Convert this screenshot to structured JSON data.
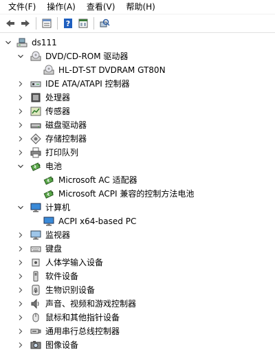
{
  "menu": [
    {
      "label": "文件(F)"
    },
    {
      "label": "操作(A)"
    },
    {
      "label": "查看(V)"
    },
    {
      "label": "帮助(H)"
    }
  ],
  "toolbar": {
    "buttons": [
      "back-arrow-icon",
      "forward-arrow-icon",
      "properties-icon",
      "help-icon",
      "view-icon",
      "scan-hardware-icon"
    ]
  },
  "tree": [
    {
      "label": "ds111",
      "level": 0,
      "expanded": true,
      "icon": "computer-root-icon"
    },
    {
      "label": "DVD/CD-ROM 驱动器",
      "level": 1,
      "expanded": true,
      "icon": "dvd-drive-icon"
    },
    {
      "label": "HL-DT-ST DVDRAM GT80N",
      "level": 2,
      "icon": "dvd-drive-icon"
    },
    {
      "label": "IDE ATA/ATAPI 控制器",
      "level": 1,
      "expanded": false,
      "icon": "ide-controller-icon"
    },
    {
      "label": "处理器",
      "level": 1,
      "expanded": false,
      "icon": "processor-icon"
    },
    {
      "label": "传感器",
      "level": 1,
      "expanded": false,
      "icon": "sensor-icon"
    },
    {
      "label": "磁盘驱动器",
      "level": 1,
      "expanded": false,
      "icon": "disk-drive-icon"
    },
    {
      "label": "存储控制器",
      "level": 1,
      "expanded": false,
      "icon": "storage-controller-icon"
    },
    {
      "label": "打印队列",
      "level": 1,
      "expanded": false,
      "icon": "printer-icon"
    },
    {
      "label": "电池",
      "level": 1,
      "expanded": true,
      "icon": "battery-icon"
    },
    {
      "label": "Microsoft AC 适配器",
      "level": 2,
      "icon": "battery-icon"
    },
    {
      "label": "Microsoft ACPI 兼容的控制方法电池",
      "level": 2,
      "icon": "battery-icon"
    },
    {
      "label": "计算机",
      "level": 1,
      "expanded": true,
      "icon": "monitor-icon"
    },
    {
      "label": "ACPI x64-based PC",
      "level": 2,
      "icon": "monitor-icon"
    },
    {
      "label": "监视器",
      "level": 1,
      "expanded": false,
      "icon": "display-icon"
    },
    {
      "label": "键盘",
      "level": 1,
      "expanded": false,
      "icon": "keyboard-icon"
    },
    {
      "label": "人体学输入设备",
      "level": 1,
      "expanded": false,
      "icon": "hid-icon"
    },
    {
      "label": "软件设备",
      "level": 1,
      "expanded": false,
      "icon": "software-device-icon"
    },
    {
      "label": "生物识别设备",
      "level": 1,
      "expanded": false,
      "icon": "fingerprint-icon"
    },
    {
      "label": "声音、视频和游戏控制器",
      "level": 1,
      "expanded": false,
      "icon": "speaker-icon"
    },
    {
      "label": "鼠标和其他指针设备",
      "level": 1,
      "expanded": false,
      "icon": "mouse-icon"
    },
    {
      "label": "通用串行总线控制器",
      "level": 1,
      "expanded": false,
      "icon": "usb-icon"
    },
    {
      "label": "图像设备",
      "level": 1,
      "expanded": false,
      "icon": "camera-icon"
    }
  ]
}
